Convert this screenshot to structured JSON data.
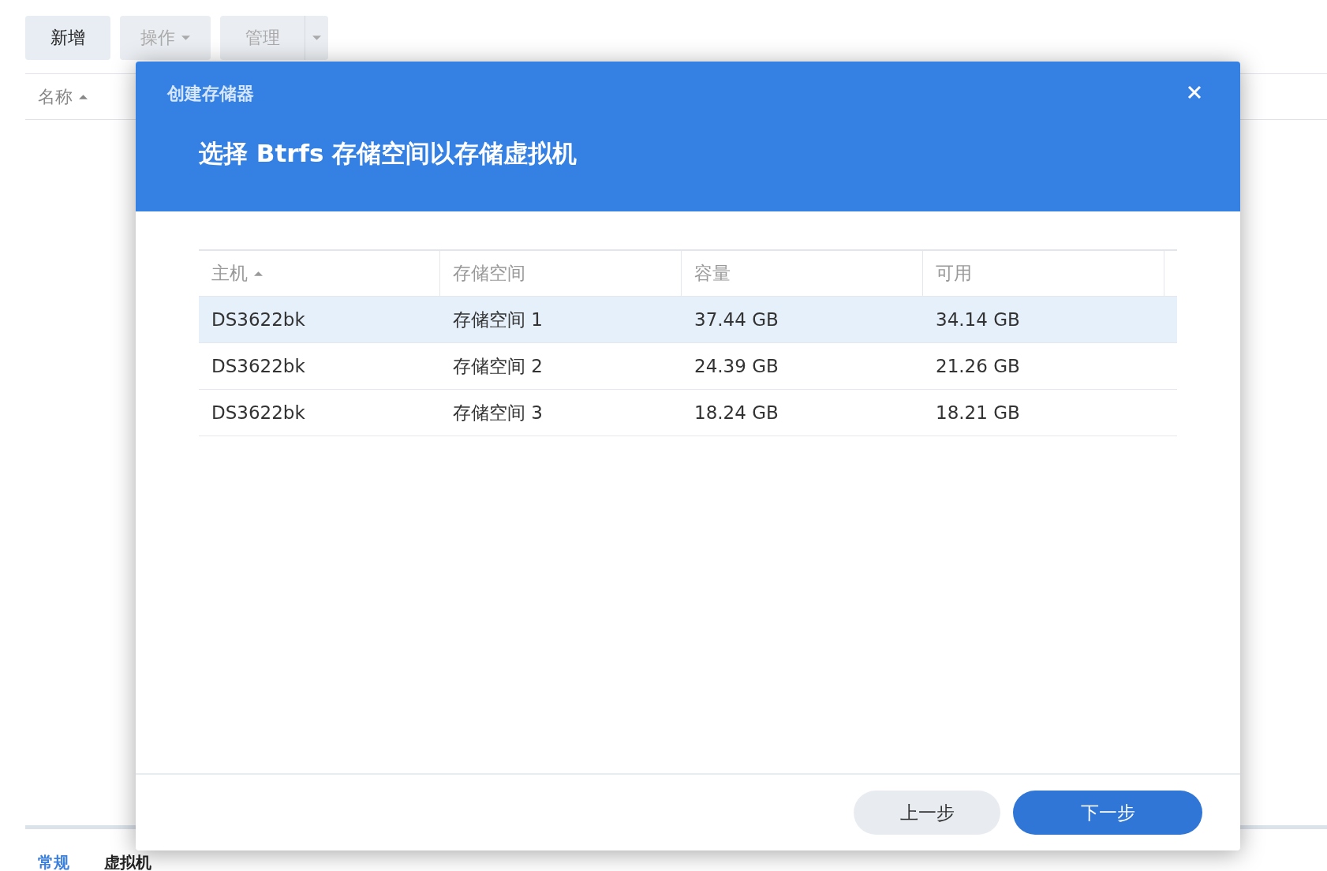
{
  "toolbar": [
    {
      "label": "新增",
      "kind": "plain",
      "disabled": false
    },
    {
      "label": "操作",
      "kind": "dropdown",
      "disabled": true
    },
    {
      "label": "管理",
      "kind": "split",
      "disabled": true
    }
  ],
  "list": {
    "columns": [
      {
        "label": "名称",
        "sorted": true
      }
    ]
  },
  "bottom_tabs": [
    {
      "label": "常规",
      "selected": true
    },
    {
      "label": "虚拟机",
      "selected": false
    }
  ],
  "dialog": {
    "title": "创建存储器",
    "heading": "选择 Btrfs 存储空间以存储虚拟机",
    "table": {
      "columns": [
        {
          "label": "主机",
          "sorted": true
        },
        {
          "label": "存储空间",
          "sorted": false
        },
        {
          "label": "容量",
          "sorted": false
        },
        {
          "label": "可用",
          "sorted": false
        }
      ],
      "rows": [
        {
          "cells": [
            "DS3622bk",
            "存储空间 1",
            "37.44 GB",
            "34.14 GB"
          ],
          "selected": true
        },
        {
          "cells": [
            "DS3622bk",
            "存储空间 2",
            "24.39 GB",
            "21.26 GB"
          ],
          "selected": false
        },
        {
          "cells": [
            "DS3622bk",
            "存储空间 3",
            "18.24 GB",
            "18.21 GB"
          ],
          "selected": false
        }
      ]
    },
    "buttons": [
      {
        "label": "上一步",
        "primary": false
      },
      {
        "label": "下一步",
        "primary": true
      }
    ]
  }
}
